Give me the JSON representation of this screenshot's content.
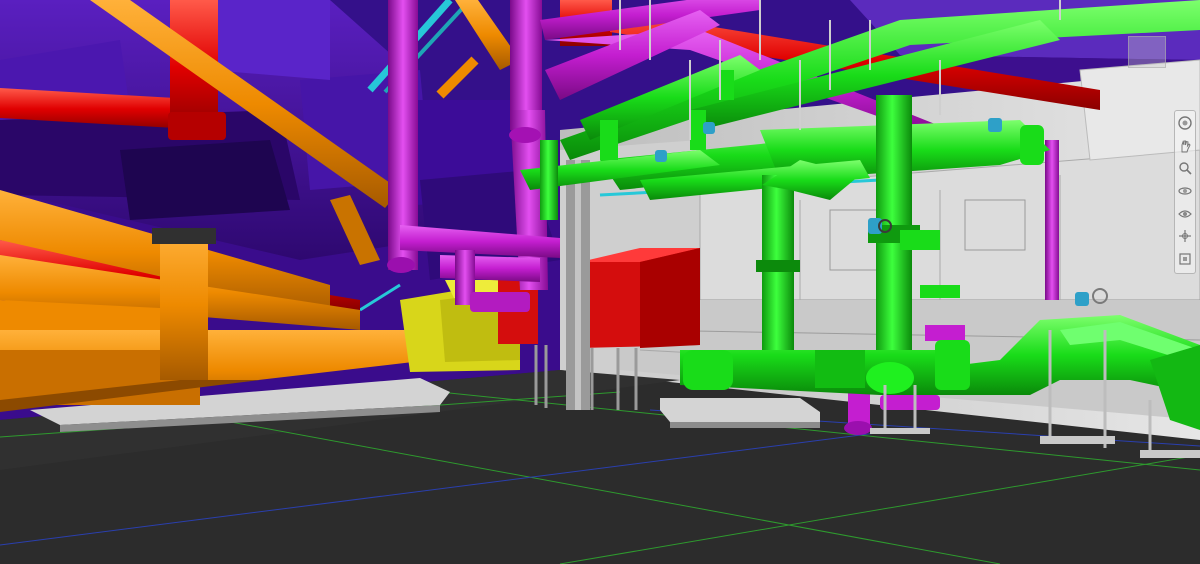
{
  "viewer": {
    "view_type": "3D BIM mechanical room view",
    "colors": {
      "floor": "#2b2b2b",
      "grid_green": "#2e9a2e",
      "grid_blue": "#2a3fae",
      "duct_purple": "#4a12a0",
      "pipe_red": "#e00000",
      "pipe_orange": "#ee8a00",
      "pipe_magenta": "#c41ed0",
      "pipe_cyan": "#27c8d8",
      "pipe_green": "#19dc19",
      "equipment_red": "#d40d0d",
      "equipment_yellow": "#d8d61a",
      "wall_gray": "#d8d8d8"
    }
  },
  "navigation_bar": {
    "tools": [
      {
        "name": "full-navigation-wheel-icon"
      },
      {
        "name": "pan-icon"
      },
      {
        "name": "zoom-icon"
      },
      {
        "name": "orbit-icon"
      },
      {
        "name": "look-icon"
      },
      {
        "name": "center-icon"
      },
      {
        "name": "zoom-extents-icon"
      }
    ]
  }
}
